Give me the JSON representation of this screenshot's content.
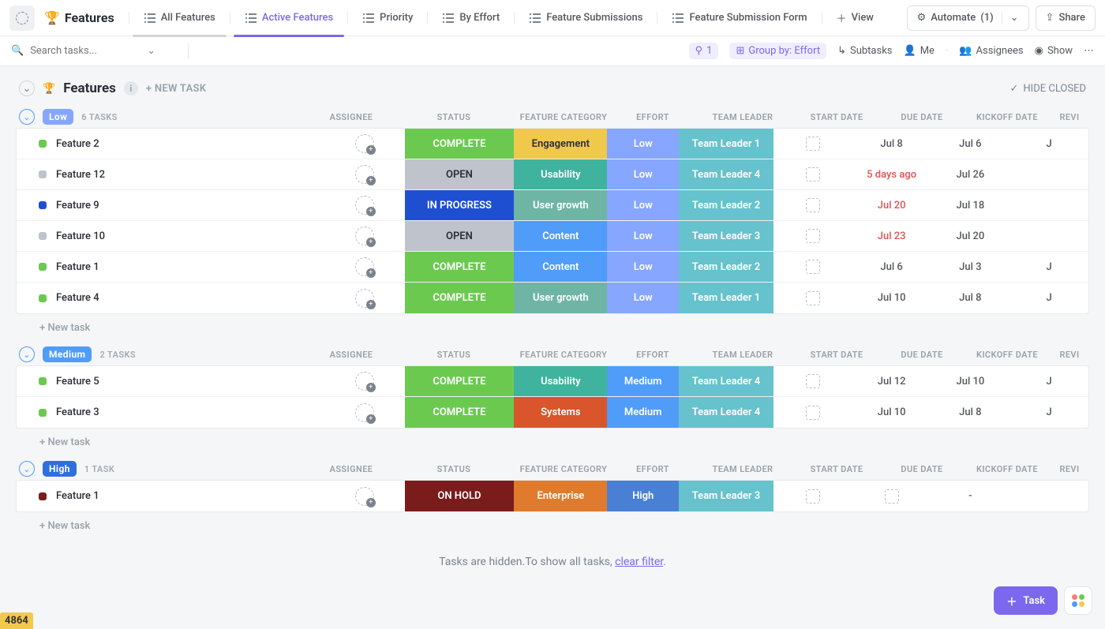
{
  "header": {
    "title": "Features",
    "tabs": [
      "All Features",
      "Active Features",
      "Priority",
      "By Effort",
      "Feature Submissions",
      "Feature Submission Form"
    ],
    "active_index": 1,
    "recent_index": 0,
    "new_view": "View",
    "automate_label": "Automate",
    "automate_count": "(1)",
    "share_label": "Share"
  },
  "toolbar": {
    "search_placeholder": "Search tasks...",
    "filter_count": "1",
    "groupby_label": "Group by: Effort",
    "subtasks_label": "Subtasks",
    "me_label": "Me",
    "assignees_label": "Assignees",
    "show_label": "Show"
  },
  "list_header": {
    "title": "Features",
    "new_task": "+ NEW TASK",
    "hide_closed": "HIDE CLOSED"
  },
  "columns": [
    "ASSIGNEE",
    "STATUS",
    "FEATURE CATEGORY",
    "EFFORT",
    "TEAM LEADER",
    "START DATE",
    "DUE DATE",
    "KICKOFF DATE",
    "REVI"
  ],
  "groups": [
    {
      "name": "Low",
      "pill": "low",
      "count": "6 TASKS",
      "rows": [
        {
          "dot": "#6bc950",
          "name": "Feature 2",
          "status": "COMPLETE",
          "status_cls": "status-complete",
          "cat": "Engagement",
          "cat_cls": "cat-engagement",
          "effort": "Low",
          "eff_cls": "eff-low",
          "leader": "Team Leader 1",
          "start": "",
          "due": "Jul 8",
          "due_red": false,
          "kick": "Jul 6",
          "rev": "J"
        },
        {
          "dot": "#bfc4cc",
          "name": "Feature 12",
          "status": "OPEN",
          "status_cls": "status-open",
          "cat": "Usability",
          "cat_cls": "cat-usability",
          "effort": "Low",
          "eff_cls": "eff-low",
          "leader": "Team Leader 4",
          "start": "",
          "due": "5 days ago",
          "due_red": true,
          "kick": "Jul 26",
          "rev": ""
        },
        {
          "dot": "#1f4fd1",
          "name": "Feature 9",
          "status": "IN PROGRESS",
          "status_cls": "status-progress",
          "cat": "User growth",
          "cat_cls": "cat-usergrowth",
          "effort": "Low",
          "eff_cls": "eff-low",
          "leader": "Team Leader 2",
          "start": "",
          "due": "Jul 20",
          "due_red": true,
          "kick": "Jul 18",
          "rev": ""
        },
        {
          "dot": "#bfc4cc",
          "name": "Feature 10",
          "status": "OPEN",
          "status_cls": "status-open",
          "cat": "Content",
          "cat_cls": "cat-content",
          "effort": "Low",
          "eff_cls": "eff-low",
          "leader": "Team Leader 3",
          "start": "",
          "due": "Jul 23",
          "due_red": true,
          "kick": "Jul 20",
          "rev": ""
        },
        {
          "dot": "#6bc950",
          "name": "Feature 1",
          "status": "COMPLETE",
          "status_cls": "status-complete",
          "cat": "Content",
          "cat_cls": "cat-content",
          "effort": "Low",
          "eff_cls": "eff-low",
          "leader": "Team Leader 2",
          "start": "",
          "due": "Jul 6",
          "due_red": false,
          "kick": "Jul 3",
          "rev": "J"
        },
        {
          "dot": "#6bc950",
          "name": "Feature 4",
          "status": "COMPLETE",
          "status_cls": "status-complete",
          "cat": "User growth",
          "cat_cls": "cat-usergrowth",
          "effort": "Low",
          "eff_cls": "eff-low",
          "leader": "Team Leader 1",
          "start": "",
          "due": "Jul 10",
          "due_red": false,
          "kick": "Jul 8",
          "rev": "J"
        }
      ]
    },
    {
      "name": "Medium",
      "pill": "medium",
      "count": "2 TASKS",
      "rows": [
        {
          "dot": "#6bc950",
          "name": "Feature 5",
          "status": "COMPLETE",
          "status_cls": "status-complete",
          "cat": "Usability",
          "cat_cls": "cat-usability",
          "effort": "Medium",
          "eff_cls": "eff-medium",
          "leader": "Team Leader 4",
          "start": "",
          "due": "Jul 12",
          "due_red": false,
          "kick": "Jul 10",
          "rev": "J"
        },
        {
          "dot": "#6bc950",
          "name": "Feature 3",
          "status": "COMPLETE",
          "status_cls": "status-complete",
          "cat": "Systems",
          "cat_cls": "cat-systems",
          "effort": "Medium",
          "eff_cls": "eff-medium",
          "leader": "Team Leader 4",
          "start": "",
          "due": "Jul 10",
          "due_red": false,
          "kick": "Jul 8",
          "rev": "J"
        }
      ]
    },
    {
      "name": "High",
      "pill": "high",
      "count": "1 TASK",
      "rows": [
        {
          "dot": "#7a1c1c",
          "name": "Feature 1",
          "status": "ON HOLD",
          "status_cls": "status-hold",
          "cat": "Enterprise",
          "cat_cls": "cat-enterprise",
          "effort": "High",
          "eff_cls": "eff-high",
          "leader": "Team Leader 3",
          "start": "",
          "due": "",
          "due_red": false,
          "kick": "-",
          "rev": ""
        }
      ]
    }
  ],
  "new_task_row": "+ New task",
  "hidden_msg_prefix": "Tasks are hidden.To show all tasks, ",
  "hidden_msg_link": "clear filter",
  "badge_id": "4864",
  "fab_label": "Task"
}
